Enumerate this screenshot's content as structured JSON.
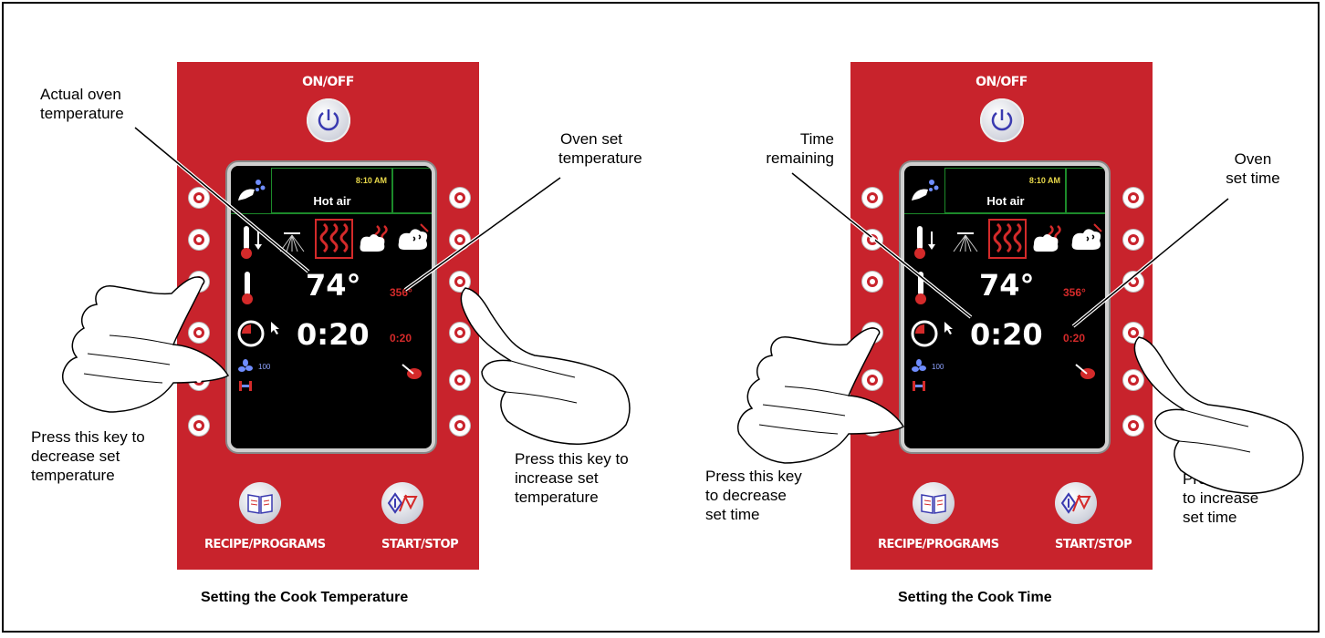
{
  "panel": {
    "on_off_label": "ON/OFF",
    "recipe_label": "RECIPE/PROGRAMS",
    "start_stop_label": "START/STOP",
    "panel_color": "#c8232c"
  },
  "screen": {
    "clock": "8:10 AM",
    "mode": "Hot air",
    "actual_temperature": "74°",
    "set_temperature": "356°",
    "time_remaining": "0:20",
    "set_time": "0:20",
    "fan_speed": "100"
  },
  "figures": [
    {
      "caption": "Setting the Cook Temperature",
      "callouts": {
        "actual_line1": "Actual oven",
        "actual_line2": "temperature",
        "set_line1": "Oven set",
        "set_line2": "temperature",
        "decrease_line1": "Press this key to",
        "decrease_line2": "decrease set",
        "decrease_line3": "temperature",
        "increase_line1": "Press this key to",
        "increase_line2": "increase set",
        "increase_line3": "temperature"
      }
    },
    {
      "caption": "Setting the Cook Time",
      "callouts": {
        "remaining_line1": "Time",
        "remaining_line2": "remaining",
        "set_line1": "Oven",
        "set_line2": "set time",
        "decrease_line1": "Press this key",
        "decrease_line2": "to decrease",
        "decrease_line3": "set time",
        "increase_line1": "Press this key",
        "increase_line2": "to increase",
        "increase_line3": "set time"
      }
    }
  ]
}
